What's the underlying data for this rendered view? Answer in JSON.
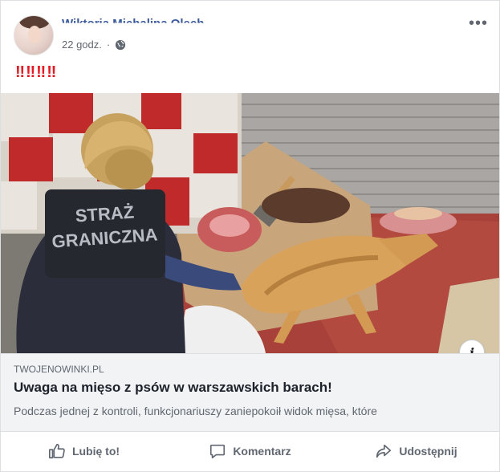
{
  "post": {
    "author": "Wiktoria Michalina Olech",
    "time": "22 godz.",
    "text": "‼‼‼‼"
  },
  "image": {
    "vest_line1": "STRAŻ",
    "vest_line2": "GRANICZNA"
  },
  "link": {
    "domain": "TWOJENOWINKI.PL",
    "title": "Uwaga na mięso z psów w warszawskich barach!",
    "description": "Podczas jednej z kontroli, funkcjonariuszy zaniepokoił widok mięsa, które"
  },
  "actions": {
    "like": "Lubię to!",
    "comment": "Komentarz",
    "share": "Udostępnij"
  },
  "colors": {
    "author": "#385898",
    "post_text": "#e41b23",
    "action_text": "#606770",
    "preview_bg": "#f2f3f5"
  },
  "icons": {
    "audience": "globe-icon",
    "menu": "more-options-icon",
    "info": "info-icon",
    "like": "thumbs-up-icon",
    "comment": "comment-bubble-icon",
    "share": "share-arrow-icon"
  }
}
